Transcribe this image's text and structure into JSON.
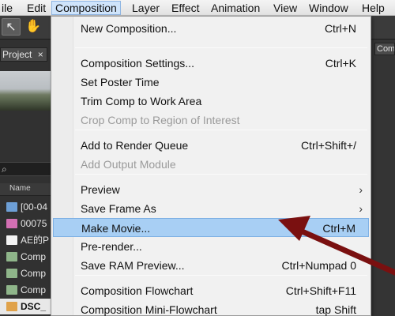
{
  "menubar": {
    "items": [
      {
        "label": "ile"
      },
      {
        "label": "Edit"
      },
      {
        "label": "Composition"
      },
      {
        "label": "Layer"
      },
      {
        "label": "Effect"
      },
      {
        "label": "Animation"
      },
      {
        "label": "View"
      },
      {
        "label": "Window"
      },
      {
        "label": "Help"
      }
    ],
    "active_index": 2
  },
  "toolbar": {
    "tools": [
      {
        "icon": "selection-arrow-icon",
        "glyph": "↖",
        "selected": true
      },
      {
        "icon": "hand-icon",
        "glyph": "✋",
        "selected": false
      }
    ]
  },
  "project_panel": {
    "tab_label": "Project",
    "tab_close": "×",
    "column_header": "Name",
    "rows": [
      {
        "label": "[00-04",
        "icon": "folder-icon",
        "icon_color": "#6d9fd6"
      },
      {
        "label": "00075",
        "icon": "image-file-icon",
        "icon_color": "#d36fb3"
      },
      {
        "label": "AE的P",
        "icon": "document-icon",
        "icon_color": "#f2f2f2"
      },
      {
        "label": "Comp",
        "icon": "composition-icon",
        "icon_color": "#8fb58a"
      },
      {
        "label": "Comp",
        "icon": "composition-icon",
        "icon_color": "#8fb58a"
      },
      {
        "label": "Comp",
        "icon": "composition-icon",
        "icon_color": "#8fb58a"
      },
      {
        "label": "DSC_",
        "icon": "image-file-icon",
        "icon_color": "#e0a24a",
        "highlighted": true
      }
    ]
  },
  "composition_tab": {
    "label": "Com"
  },
  "composition_menu": {
    "items": [
      {
        "label": "New Composition...",
        "shortcut": "Ctrl+N"
      },
      {
        "label": "Composition Settings...",
        "shortcut": "Ctrl+K"
      },
      {
        "label": "Set Poster Time",
        "shortcut": ""
      },
      {
        "label": "Trim Comp to Work Area",
        "shortcut": ""
      },
      {
        "label": "Crop Comp to Region of Interest",
        "shortcut": "",
        "disabled": true
      },
      {
        "label": "Add to Render Queue",
        "shortcut": "Ctrl+Shift+/"
      },
      {
        "label": "Add Output Module",
        "shortcut": "",
        "disabled": true
      },
      {
        "label": "Preview",
        "shortcut": "",
        "submenu": true
      },
      {
        "label": "Save Frame As",
        "shortcut": "",
        "submenu": true
      },
      {
        "label": "Make Movie...",
        "shortcut": "Ctrl+M",
        "highlighted": true
      },
      {
        "label": "Pre-render...",
        "shortcut": ""
      },
      {
        "label": "Save RAM Preview...",
        "shortcut": "Ctrl+Numpad 0"
      },
      {
        "label": "Composition Flowchart",
        "shortcut": "Ctrl+Shift+F11"
      },
      {
        "label": "Composition Mini-Flowchart",
        "shortcut": "tap Shift"
      }
    ],
    "submenu_glyph": "›"
  },
  "annotation": {
    "arrow_color": "#7a1010"
  }
}
